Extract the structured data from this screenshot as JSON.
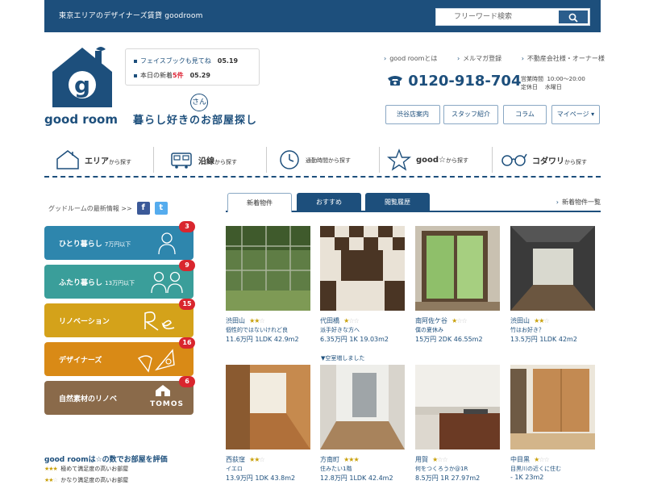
{
  "topbar": {
    "tagline": "東京エリアのデザイナーズ賃貸 goodroom",
    "search_placeholder": "フリーワード検索"
  },
  "logo": {
    "wordmark": "good room",
    "letter": "g"
  },
  "slogan": {
    "text": "暮らし好きのお部屋探し",
    "ruby": "さん"
  },
  "news": [
    {
      "text": "フェイスブックも見てね",
      "date": "05.19"
    },
    {
      "text_before": "本日の新着",
      "count": "5件",
      "date": "05.29"
    }
  ],
  "toplinks": [
    "good roomとは",
    "メルマガ登録",
    "不動産会社様・オーナー様"
  ],
  "phone": {
    "number": "0120-918-704",
    "hours_label": "営業時間",
    "hours_value": "10:00〜20:00",
    "holiday_label": "定休日",
    "holiday_value": "水曜日"
  },
  "subnav": [
    "渋谷店案内",
    "スタッフ紹介",
    "コラム",
    "マイページ ▾"
  ],
  "mainnav": [
    {
      "main": "エリア",
      "suffix": "から探す",
      "icon": "house-icon"
    },
    {
      "main": "沿線",
      "suffix": "から探す",
      "icon": "train-icon"
    },
    {
      "main": "",
      "suffix": "通勤時間から探す",
      "icon": "clock-icon"
    },
    {
      "main": "good☆",
      "suffix": "から探す",
      "icon": "star-icon"
    },
    {
      "main": "コダワリ",
      "suffix": "から探す",
      "icon": "glasses-icon"
    }
  ],
  "social": {
    "label": "グッドルームの最新情報 >>"
  },
  "categories": [
    {
      "label": "ひとり暮らし",
      "sub": "7万円以下",
      "badge": "3",
      "color": "#2e86ad"
    },
    {
      "label": "ふたり暮らし",
      "sub": "13万円以下",
      "badge": "9",
      "color": "#3a9e9a"
    },
    {
      "label": "リノベーション",
      "sub": "",
      "badge": "15",
      "color": "#d4a21a"
    },
    {
      "label": "デザイナーズ",
      "sub": "",
      "badge": "16",
      "color": "#d98a16"
    },
    {
      "label": "自然素材のリノベ",
      "sub": "",
      "badge": "6",
      "color": "#8a6a4a",
      "brand": "TOMOS"
    }
  ],
  "evaluation": {
    "title": "good roomは☆の数でお部屋を評価",
    "rows": [
      {
        "stars": 3,
        "text": "極めて満足度の高いお部屋"
      },
      {
        "stars": 2,
        "text": "かなり満足度の高いお部屋"
      }
    ]
  },
  "tabs": {
    "items": [
      "新着物件",
      "おすすめ",
      "閲覧履歴"
    ],
    "more": "新着物件一覧"
  },
  "properties": [
    {
      "area": "渋田山",
      "stars": 2,
      "desc": "個性的ではないけれど良",
      "detail": "11.6万円 1LDK 42.9m2"
    },
    {
      "area": "代田橋",
      "stars": 1,
      "desc": "派手好きな方へ",
      "detail": "6.35万円 1K 19.03m2"
    },
    {
      "area": "南阿佐ケ谷",
      "stars": 1,
      "desc": "僕の夏休み",
      "detail": "15万円 2DK 46.55m2"
    },
    {
      "area": "渋田山",
      "stars": 2,
      "desc": "竹はお好き？",
      "detail": "13.5万円 1LDK 42m2"
    },
    {
      "area": "西荻窪",
      "stars": 2,
      "desc": "イエロ",
      "detail": "13.9万円 1DK 43.8m2"
    },
    {
      "area": "方南町",
      "stars": 3,
      "desc": "住みたい1階",
      "detail": "12.8万円 1LDK 42.4m2"
    },
    {
      "area": "用賀",
      "stars": 1,
      "desc": "何をつくろうか@1R",
      "detail": "8.5万円 1R 27.97m2"
    },
    {
      "area": "中目黒",
      "stars": 1,
      "desc": "目黒川の近くに住む",
      "detail": "- 1K 23m2"
    }
  ],
  "show_more": "▼空室増しました"
}
